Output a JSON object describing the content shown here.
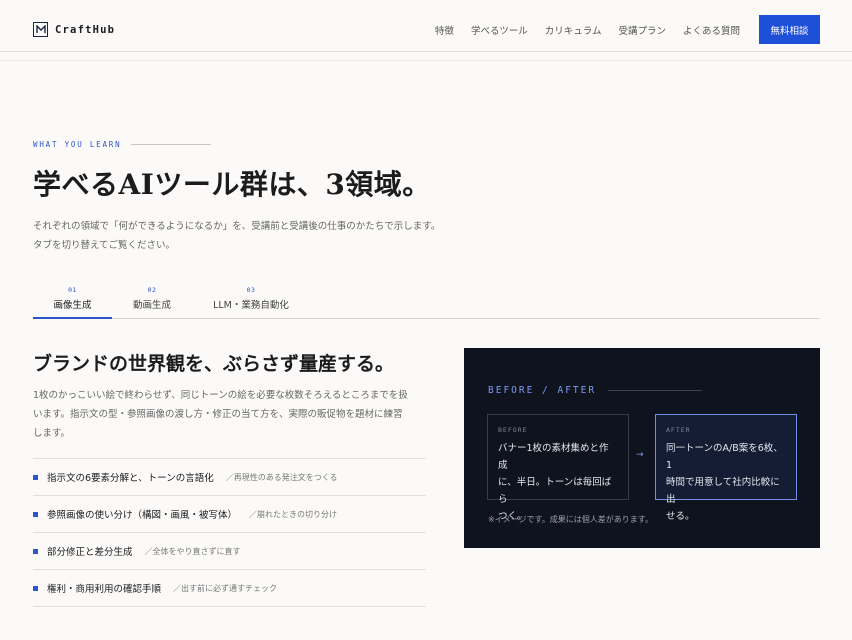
{
  "header": {
    "logo_text": "CraftHub",
    "nav": [
      "特徴",
      "学べるツール",
      "カリキュラム",
      "受講プラン",
      "よくある質問"
    ],
    "cta_label": "無料相談"
  },
  "section": {
    "eyebrow": "WHAT YOU LEARN",
    "headline": "学べるAIツール群は、3領域。",
    "lead_lines": [
      "それぞれの領域で「何ができるようになるか」を、受講前と受講後の仕事のかたちで示します。",
      "タブを切り替えてご覧ください。"
    ]
  },
  "tabs": [
    {
      "num": "01",
      "label": "画像生成",
      "active": true
    },
    {
      "num": "02",
      "label": "動画生成",
      "active": false
    },
    {
      "num": "03",
      "label": "LLM・業務自動化",
      "active": false
    }
  ],
  "content": {
    "title": "ブランドの世界観を、ぶらさず量産する。",
    "desc_lines": [
      "1枚のかっこいい絵で終わらせず、同じトーンの絵を必要な枚数そろえるところまでを扱",
      "います。指示文の型・参照画像の渡し方・修正の当て方を、実際の販促物を題材に練習",
      "します。"
    ],
    "features": [
      {
        "main": "指示文の6要素分解と、トーンの言語化",
        "note": "／再現性のある発注文をつくる"
      },
      {
        "main": "参照画像の使い分け（構図・画風・被写体）",
        "note": "／崩れたときの切り分け"
      },
      {
        "main": "部分修正と差分生成",
        "note": "／全体をやり直さずに直す"
      },
      {
        "main": "権利・商用利用の確認手順",
        "note": "／出す前に必ず通すチェック"
      }
    ]
  },
  "panel": {
    "heading": "BEFORE / AFTER",
    "before_label": "BEFORE",
    "before_lines": [
      "バナー1枚の素材集めと作成",
      "に、半日。トーンは毎回ばら",
      "つく。"
    ],
    "arrow": "→",
    "after_label": "AFTER",
    "after_lines": [
      "同一トーンのA/B案を6枚、1",
      "時間で用意して社内比較に出",
      "せる。"
    ],
    "note": "※イメージです。成果には個人差があります。"
  },
  "colors": {
    "accent": "#1e4fd8",
    "panel_bg": "#0f131d",
    "after_border": "#6f8fe8"
  }
}
